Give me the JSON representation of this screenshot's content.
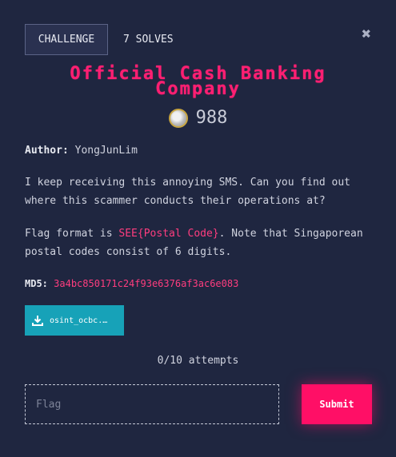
{
  "tabs": {
    "challenge_label": "CHALLENGE",
    "solves_label": "7 SOLVES"
  },
  "close_icon": "close-icon",
  "challenge": {
    "title_line1": "Official Cash Banking",
    "title_line2": "Company",
    "points": "988",
    "author_label": "Author:",
    "author_name": "YongJunLim",
    "description": "I keep receiving this annoying SMS. Can you find out where this scammer conducts their operations at?",
    "flag_format_prefix": "Flag format is ",
    "flag_format_value": "SEE{Postal Code}",
    "flag_format_suffix": ". Note that Singaporean postal codes consist of 6 digits.",
    "md5_label": "MD5:",
    "md5_value": "3a4bc850171c24f93e6376af3ac6e083"
  },
  "file": {
    "name": "osint_ocbc.…",
    "icon": "download-icon"
  },
  "attempts": "0/10 attempts",
  "flag_input": {
    "placeholder": "Flag",
    "value": ""
  },
  "submit_label": "Submit",
  "colors": {
    "background": "#1f2640",
    "accent": "#ff0f66",
    "file_button": "#17a2b8"
  }
}
